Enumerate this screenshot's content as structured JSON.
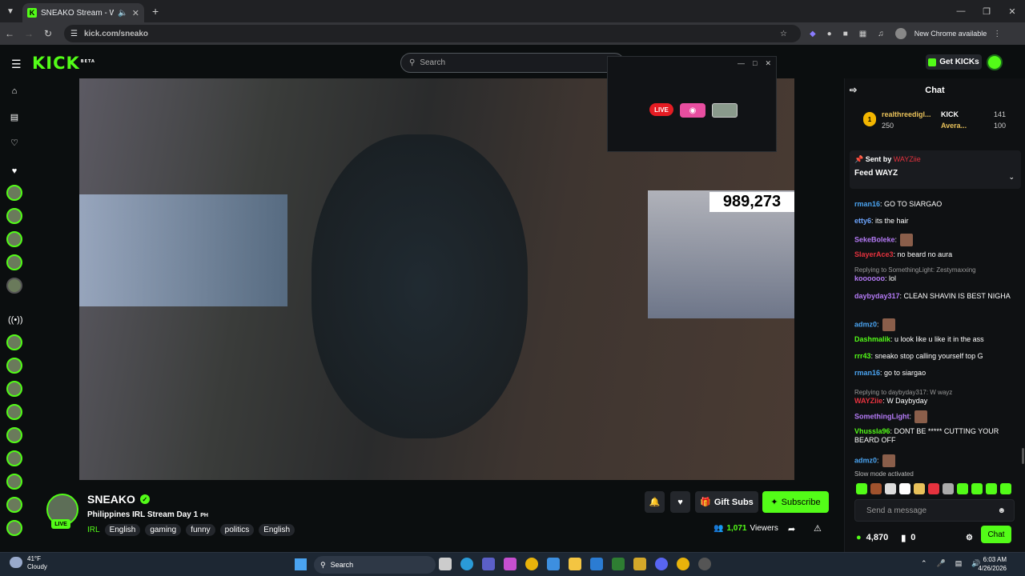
{
  "browser": {
    "tab_title": "SNEAKO Stream - Watch Li...",
    "url": "kick.com/sneako",
    "new_chrome": "New Chrome available"
  },
  "kick": {
    "logo": "KICK",
    "beta": "BETA",
    "search_placeholder": "Search",
    "get_kicks": "Get KICKs"
  },
  "video": {
    "counter": "989,273"
  },
  "popup": {
    "live": "LIVE"
  },
  "stream": {
    "live_badge": "LIVE",
    "name": "SNEAKO",
    "title": "Philippines IRL Stream Day 1",
    "title_suffix": "PH",
    "category": "IRL",
    "tags": [
      "English",
      "gaming",
      "funny",
      "politics",
      "English"
    ],
    "gift_subs": "Gift Subs",
    "subscribe": "Subscribe",
    "viewers_count": "1,071",
    "viewers_label": "Viewers"
  },
  "chat": {
    "header": "Chat",
    "leaderboard": {
      "rank": "1",
      "top_name": "realthreedigl...",
      "top_value": "250",
      "kick_label": "KICK",
      "kick_value": "141",
      "avg_label": "Avera...",
      "avg_value": "100"
    },
    "pinned": {
      "sent_by": "Sent by",
      "sender": "WAYZiie",
      "message": "Feed WAYZ"
    },
    "messages": [
      {
        "user": "rman16",
        "color": "#4aa3f0",
        "text": ": GO TO SIARGAO",
        "reply": ""
      },
      {
        "user": "etty6",
        "color": "#6ea6ff",
        "text": ": its the hair",
        "reply": ""
      },
      {
        "user": "SekeBoleke",
        "color": "#b57bf7",
        "text": ":",
        "reply": ""
      },
      {
        "user": "SlayerAce3",
        "color": "#e6323e",
        "text": ": no beard no aura",
        "reply": ""
      },
      {
        "user": "koooooo",
        "color": "#b57bf7",
        "text": ": lol",
        "reply": "Replying to SomethingLight: Zestymaxxing"
      },
      {
        "user": "daybyday317",
        "color": "#b57bf7",
        "text": ": CLEAN SHAVIN IS BEST NIGHA",
        "reply": ""
      },
      {
        "user": "admz0",
        "color": "#4aa3f0",
        "text": ":",
        "reply": ""
      },
      {
        "user": "Dashmalik",
        "color": "#53fc18",
        "text": ": u look like u like it in the ass",
        "reply": ""
      },
      {
        "user": "rrr43",
        "color": "#53fc18",
        "text": ": sneako stop calling yourself top G",
        "reply": ""
      },
      {
        "user": "rman16",
        "color": "#4aa3f0",
        "text": ": go to siargao",
        "reply": ""
      },
      {
        "user": "WAYZiie",
        "color": "#e6323e",
        "text": ": W Daybyday",
        "reply": "Replying to daybyday317: W wayz"
      },
      {
        "user": "SomethingLight",
        "color": "#b57bf7",
        "text": ":",
        "reply": ""
      },
      {
        "user": "Vhussla96",
        "color": "#53fc18",
        "text": ": DONT BE ***** CUTTING YOUR BEARD OFF",
        "reply": ""
      },
      {
        "user": "admz0",
        "color": "#4aa3f0",
        "text": ":",
        "reply": ""
      }
    ],
    "slow_mode": "Slow mode activated",
    "send_placeholder": "Send a message",
    "kicks_balance": "4,870",
    "gift_count": "0",
    "chat_button": "Chat"
  },
  "taskbar": {
    "temp": "41°F",
    "weather": "Cloudy",
    "search": "Search",
    "time": "6:03 AM",
    "date": "4/26/2026"
  },
  "colors": {
    "brand": "#53fc18",
    "background": "#0b0e0f"
  }
}
